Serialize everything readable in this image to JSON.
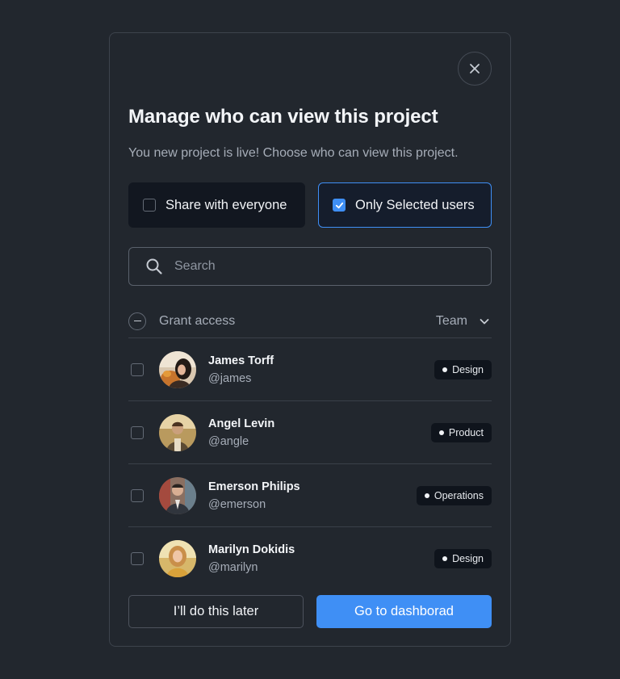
{
  "modal": {
    "title": "Manage who can view this project",
    "subtitle": "You new project is live! Choose who can view this project."
  },
  "options": {
    "everyone_label": "Share with everyone",
    "everyone_checked": false,
    "selected_label": "Only Selected users",
    "selected_checked": true
  },
  "search": {
    "placeholder": "Search",
    "icon": "search-icon"
  },
  "list_header": {
    "grant_label": "Grant access",
    "team_label": "Team"
  },
  "users": [
    {
      "name": "James Torff",
      "handle": "@james",
      "team": "Design"
    },
    {
      "name": "Angel Levin",
      "handle": "@angle",
      "team": "Product"
    },
    {
      "name": "Emerson Philips",
      "handle": "@emerson",
      "team": "Operations"
    },
    {
      "name": "Marilyn Dokidis",
      "handle": "@marilyn",
      "team": "Design"
    }
  ],
  "footer": {
    "later_label": "I’ll do this later",
    "go_label": "Go to dashborad"
  },
  "colors": {
    "background": "#22272e",
    "accent": "#3f8ff5",
    "badge_bg": "#0f141c"
  }
}
